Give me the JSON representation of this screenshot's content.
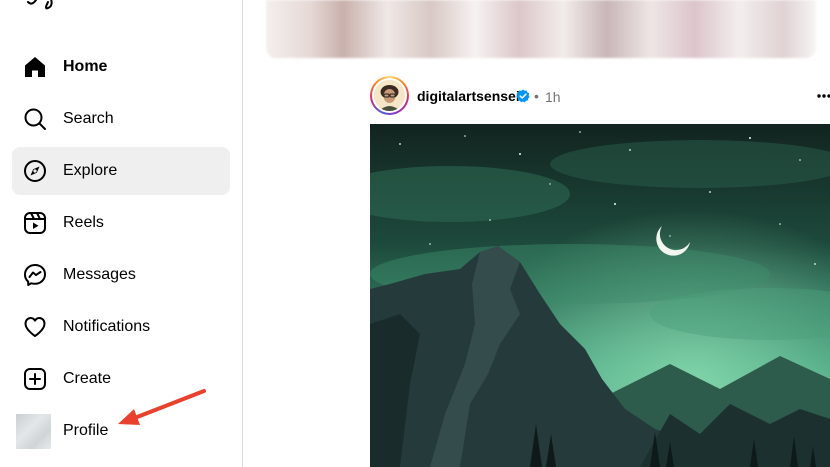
{
  "sidebar": {
    "items": [
      {
        "id": "home",
        "label": "Home",
        "icon": "home-icon",
        "bold": true
      },
      {
        "id": "search",
        "label": "Search",
        "icon": "search-icon"
      },
      {
        "id": "explore",
        "label": "Explore",
        "icon": "explore-compass-icon",
        "active": true
      },
      {
        "id": "reels",
        "label": "Reels",
        "icon": "reels-icon"
      },
      {
        "id": "messages",
        "label": "Messages",
        "icon": "messenger-icon"
      },
      {
        "id": "notifications",
        "label": "Notifications",
        "icon": "heart-icon"
      },
      {
        "id": "create",
        "label": "Create",
        "icon": "plus-square-icon"
      },
      {
        "id": "profile",
        "label": "Profile",
        "icon": "profile-avatar"
      }
    ]
  },
  "post": {
    "username": "digitalartsensei",
    "verified": true,
    "separator": "•",
    "time": "1h"
  },
  "colors": {
    "active_bg": "#efefef",
    "verified": "#0095f6",
    "annotation_arrow": "#e8412d",
    "muted_text": "#737373"
  }
}
